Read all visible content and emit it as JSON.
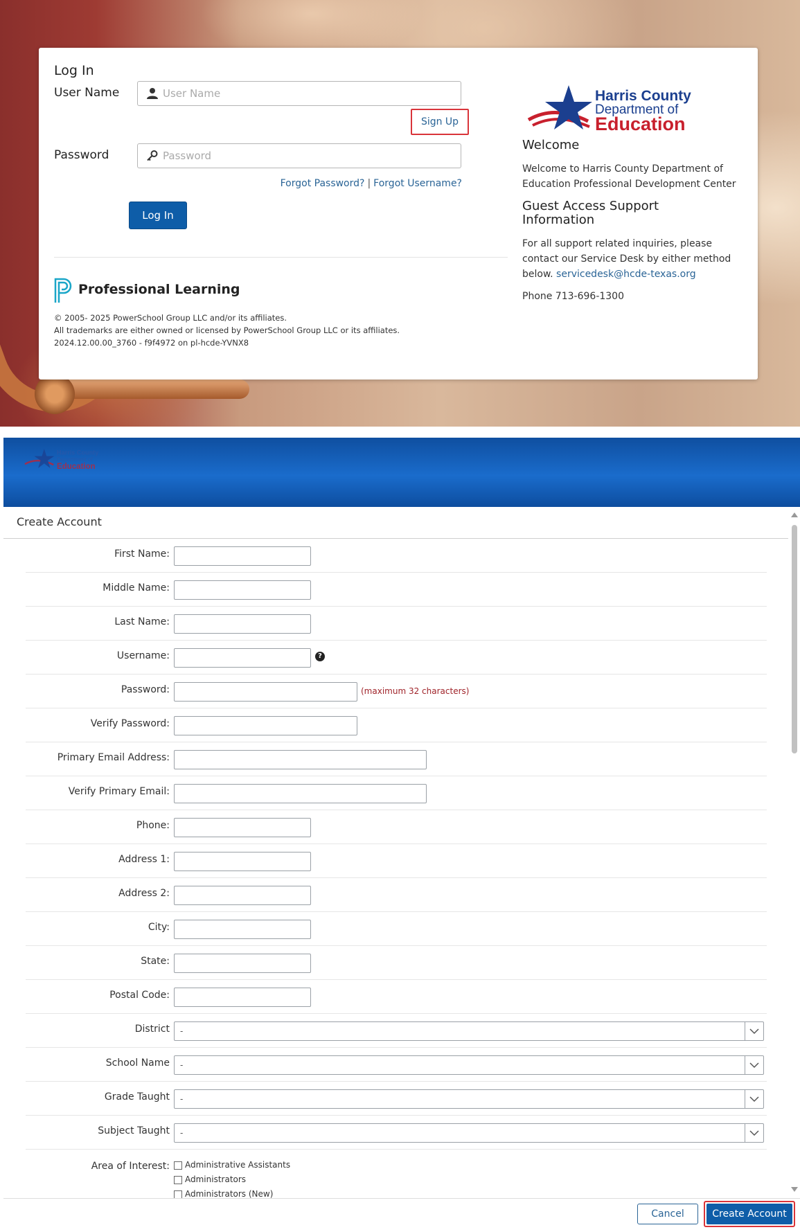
{
  "login": {
    "title": "Log In",
    "username_label": "User Name",
    "username_placeholder": "User Name",
    "signup_link": "Sign Up",
    "password_label": "Password",
    "password_placeholder": "Password",
    "forgot_password": "Forgot Password?",
    "separator": "|",
    "forgot_username": "Forgot Username?",
    "login_button": "Log In",
    "product_name": "Professional Learning",
    "legal_line1": "© 2005- 2025 PowerSchool Group LLC and/or its affiliates.",
    "legal_line2": "All trademarks are either owned or licensed by PowerSchool Group LLC or its affiliates.",
    "legal_line3": "2024.12.00.00_3760 - f9f4972 on pl-hcde-YVNX8"
  },
  "brand": {
    "logo_line1": "Harris County",
    "logo_line2": "Department of",
    "logo_line3": "Education",
    "navy": "#1b3f8f",
    "red": "#c8202d"
  },
  "welcome": {
    "heading": "Welcome",
    "text": "Welcome to Harris County Department of Education Professional Development Center",
    "support_heading": "Guest Access Support Information",
    "support_text": "For all support related inquiries, please contact our Service Desk by either method below.",
    "support_email": "servicedesk@hcde-texas.org",
    "phone": "Phone 713-696-1300"
  },
  "create": {
    "title": "Create Account",
    "fields": {
      "first_name": "First Name:",
      "middle_name": "Middle Name:",
      "last_name": "Last Name:",
      "username": "Username:",
      "password": "Password:",
      "password_hint": "(maximum 32 characters)",
      "verify_password": "Verify Password:",
      "primary_email": "Primary Email Address:",
      "verify_email": "Verify Primary Email:",
      "phone": "Phone:",
      "address1": "Address 1:",
      "address2": "Address 2:",
      "city": "City:",
      "state": "State:",
      "postal_code": "Postal Code:",
      "district": "District",
      "school_name": "School Name",
      "grade_taught": "Grade Taught",
      "subject_taught": "Subject Taught",
      "area_of_interest": "Area of Interest:"
    },
    "select_default": "-",
    "help_glyph": "?",
    "areas_of_interest": [
      "Administrative Assistants",
      "Administrators",
      "Administrators (New)"
    ],
    "cancel_button": "Cancel",
    "create_button": "Create Account"
  }
}
